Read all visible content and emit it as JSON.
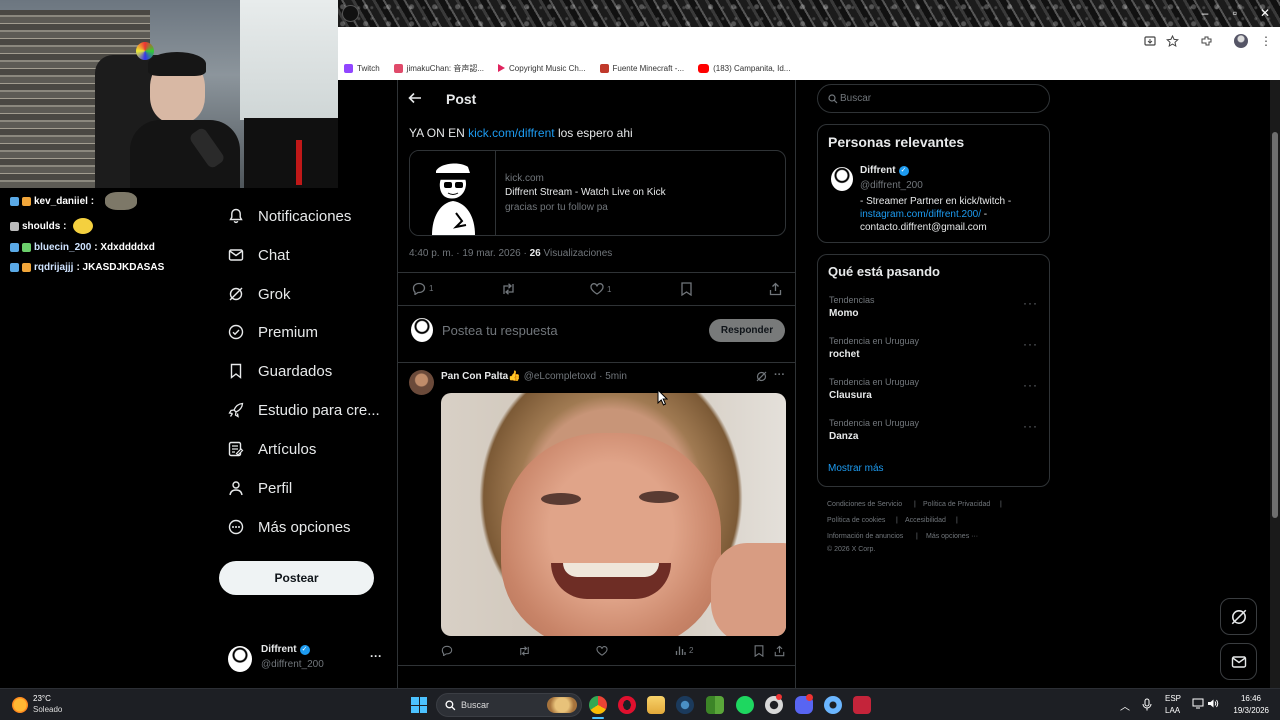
{
  "browser": {
    "bookmarks": [
      {
        "label": "Twitch",
        "color": "#9146ff"
      },
      {
        "label": "jimakuChan: 音声認...",
        "color": "#e04a6a"
      },
      {
        "label": "Copyright Music Ch...",
        "color": "#e0245e"
      },
      {
        "label": "Fuente Minecraft -...",
        "color": "#c0392b"
      },
      {
        "label": "(183) Campanita, Id...",
        "color": "#ff0000"
      }
    ]
  },
  "chat": {
    "messages": [
      {
        "user": "kev_daniiel :",
        "text": ""
      },
      {
        "user": "shoulds :",
        "text": ""
      },
      {
        "user": "bluecin_200",
        "text": ": Xdxddddxd"
      },
      {
        "user": "rqdrijajjj",
        "text": ": JKASDJKDASAS"
      }
    ]
  },
  "nav": {
    "items": [
      "Notificaciones",
      "Chat",
      "Grok",
      "Premium",
      "Guardados",
      "Estudio para cre...",
      "Artículos",
      "Perfil",
      "Más opciones"
    ],
    "post_button": "Postear",
    "account": {
      "name": "Diffrent",
      "handle": "@diffrent_200",
      "more": "···"
    }
  },
  "post": {
    "header": "Post",
    "text_before": "YA ON EN ",
    "link": "kick.com/diffrent",
    "text_after": " los espero ahi",
    "card": {
      "domain": "kick.com",
      "title": "Diffrent Stream - Watch Live on Kick",
      "desc": "gracias por tu follow pa"
    },
    "meta_time": "4:40 p. m. · 19 mar. 2026 · ",
    "meta_views_count": "26",
    "meta_views_label": " Visualizaciones",
    "reply_count": "1",
    "like_count": "1",
    "reply_placeholder": "Postea tu respuesta",
    "reply_button": "Responder"
  },
  "reply": {
    "name": "Pan Con Palta👍",
    "handle": "@eLcompletoxd",
    "time": "· 5min",
    "views": "2",
    "more": "···"
  },
  "sidebar": {
    "search_placeholder": "Buscar",
    "relevant": {
      "title": "Personas relevantes",
      "name": "Diffrent",
      "handle": "@diffrent_200",
      "bio1": "- Streamer Partner en kick/twitch -",
      "bio_link": "instagram.com/diffrent.200/",
      "bio_link_suffix": " -",
      "bio2": "contacto.diffrent@gmail.com"
    },
    "trends": {
      "title": "Qué está pasando",
      "items": [
        {
          "category": "Tendencias",
          "name": "Momo"
        },
        {
          "category": "Tendencia en Uruguay",
          "name": "rochet"
        },
        {
          "category": "Tendencia en Uruguay",
          "name": "Clausura"
        },
        {
          "category": "Tendencia en Uruguay",
          "name": "Danza"
        }
      ],
      "more_dots": "···",
      "show_more": "Mostrar más"
    },
    "footer": {
      "terms": "Condiciones de Servicio",
      "privacy": "Política de Privacidad",
      "cookies": "Política de cookies",
      "accessibility": "Accesibilidad",
      "ads": "Información de anuncios",
      "more": "Más opciones ···",
      "copyright": "© 2026 X Corp.",
      "sep": "|"
    }
  },
  "taskbar": {
    "weather_temp": "23°C",
    "weather_desc": "Soleado",
    "search": "Buscar",
    "lang1": "ESP",
    "lang2": "LAA",
    "time": "16:46",
    "date": "19/3/2026"
  },
  "colors": {
    "accent": "#1d9bf0",
    "verified": "#1d9bf0"
  }
}
